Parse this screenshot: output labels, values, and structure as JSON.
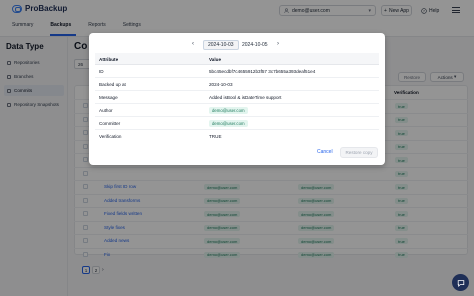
{
  "app": {
    "name": "ProBackup"
  },
  "nav": {
    "tabs": [
      {
        "label": "Summary"
      },
      {
        "label": "Backups",
        "active": true
      },
      {
        "label": "Reports"
      },
      {
        "label": "Settings"
      }
    ]
  },
  "header": {
    "user_select_value": "demo@user.com",
    "new_app_label": "New App",
    "help_label": "Help"
  },
  "sidebar": {
    "title": "Data Type",
    "items": [
      {
        "label": "Repositories",
        "icon": "repository-icon"
      },
      {
        "label": "Branches",
        "icon": "branch-icon"
      },
      {
        "label": "Commits",
        "icon": "commit-icon",
        "active": true
      },
      {
        "label": "Repository Snapshots",
        "icon": "snapshot-icon"
      }
    ]
  },
  "background": {
    "page_title": "Co",
    "filter_value": "26",
    "actions": {
      "disabled_label": "Restore",
      "actions_label": "Actions"
    },
    "column_verification": "Verification",
    "rows": [
      {
        "message": "",
        "author": "",
        "committer": "",
        "verification": "true"
      },
      {
        "message": "",
        "author": "",
        "committer": "",
        "verification": "true"
      },
      {
        "message": "",
        "author": "",
        "committer": "",
        "verification": "true"
      },
      {
        "message": "",
        "author": "",
        "committer": "",
        "verification": "true"
      },
      {
        "message": "",
        "author": "",
        "committer": "",
        "verification": "true"
      },
      {
        "message": "",
        "author": "",
        "committer": "",
        "verification": "true"
      },
      {
        "message": "Skip first ID row",
        "author": "demo@user.com",
        "committer": "demo@user.com",
        "verification": "true"
      },
      {
        "message": "Added transforms",
        "author": "demo@user.com",
        "committer": "demo@user.com",
        "verification": "true"
      },
      {
        "message": "Fixed fields written",
        "author": "demo@user.com",
        "committer": "demo@user.com",
        "verification": "true"
      },
      {
        "message": "Style fixes",
        "author": "demo@user.com",
        "committer": "demo@user.com",
        "verification": "true"
      },
      {
        "message": "Added news",
        "author": "demo@user.com",
        "committer": "demo@user.com",
        "verification": "true"
      },
      {
        "message": "Fix",
        "author": "demo@user.com",
        "committer": "demo@user.com",
        "verification": "true"
      }
    ],
    "pagination": {
      "pages": [
        "1",
        "2"
      ],
      "current": "1",
      "next": "›"
    }
  },
  "modal": {
    "date_prev": "‹",
    "date_next": "›",
    "dates": [
      "2024-10-03",
      "2024-10-05"
    ],
    "selected_date": "2024-10-03",
    "table_headers": {
      "attribute": "Attribute",
      "value": "Value"
    },
    "rows": [
      {
        "attribute": "ID",
        "value": "5bc45ecdbf7c4655912b3f57 3c7b655a393deaf51e4"
      },
      {
        "attribute": "Backed up at",
        "value": "2024-10-03"
      },
      {
        "attribute": "Message",
        "value": "Added isBool & isDateTime support"
      },
      {
        "attribute": "Author",
        "value": "demo@user.com",
        "tag": true
      },
      {
        "attribute": "Committer",
        "value": "demo@user.com",
        "tag": true
      },
      {
        "attribute": "Verification",
        "value": "TRUE"
      }
    ],
    "cancel_label": "Cancel",
    "restore_label": "Restore copy"
  },
  "colors": {
    "accent": "#2563eb",
    "brand": "#1f2f57",
    "tag_bg": "#e3f5ef",
    "tag_text": "#1e7a5c"
  }
}
